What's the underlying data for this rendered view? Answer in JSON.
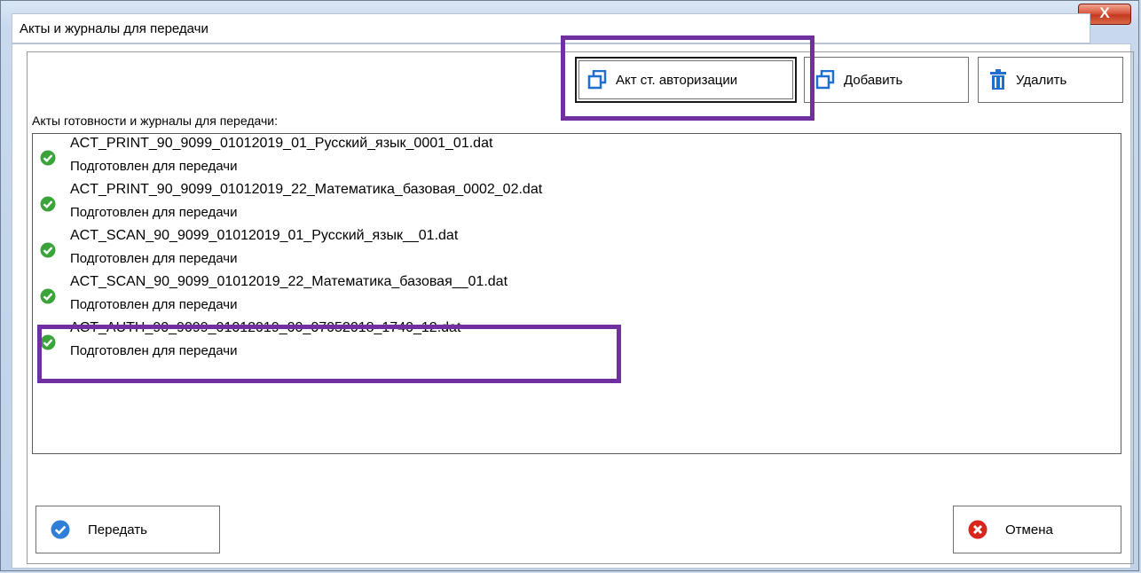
{
  "window": {
    "title": "Акты и журналы для передачи",
    "close_label": "X"
  },
  "toolbar": {
    "auth_act_label": "Акт ст. авторизации",
    "add_label": "Добавить",
    "delete_label": "Удалить"
  },
  "list": {
    "label": "Акты готовности и журналы для передачи:",
    "items": [
      {
        "filename": "ACT_PRINT_90_9099_01012019_01_Русский_язык_0001_01.dat",
        "status": "Подготовлен для передачи"
      },
      {
        "filename": "ACT_PRINT_90_9099_01012019_22_Математика_базовая_0002_02.dat",
        "status": "Подготовлен для передачи"
      },
      {
        "filename": "ACT_SCAN_90_9099_01012019_01_Русский_язык__01.dat",
        "status": "Подготовлен для передачи"
      },
      {
        "filename": "ACT_SCAN_90_9099_01012019_22_Математика_базовая__01.dat",
        "status": "Подготовлен для передачи"
      },
      {
        "filename": "ACT_AUTH_90_9099_01012019_00_07052018_1740_12.dat",
        "status": "Подготовлен для передачи"
      }
    ]
  },
  "footer": {
    "send_label": "Передать",
    "cancel_label": "Отмена"
  },
  "icons": {
    "copy": "copy-icon",
    "trash": "trash-icon",
    "check": "check-circle-icon",
    "cancel": "cancel-circle-icon"
  },
  "colors": {
    "highlight": "#7030a0",
    "check_green": "#3aa33a",
    "send_blue": "#2f7fd6",
    "cancel_red": "#d9261c",
    "icon_blue": "#1e6fd0"
  }
}
